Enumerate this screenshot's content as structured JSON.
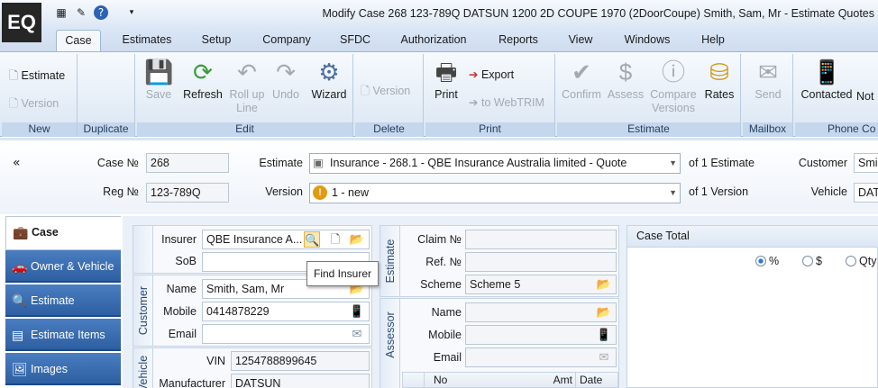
{
  "app": {
    "logo": "EQ",
    "title": "Modify Case 268 123-789Q DATSUN 1200  2D COUPE 1970 (2DoorCoupe) Smith, Sam, Mr - Estimate Quotes"
  },
  "menu": {
    "tabs": [
      "Case",
      "Estimates",
      "Setup",
      "Company",
      "SFDC",
      "Authorization",
      "Reports",
      "View",
      "Windows",
      "Help"
    ],
    "active": "Case"
  },
  "ribbon": {
    "new": {
      "label": "New",
      "estimate": "Estimate",
      "version": "Version"
    },
    "duplicate": {
      "label": "Duplicate"
    },
    "edit": {
      "label": "Edit",
      "save": "Save",
      "refresh": "Refresh",
      "rollup": "Roll up Line",
      "undo": "Undo",
      "wizard": "Wizard"
    },
    "delete": {
      "label": "Delete",
      "version": "Version"
    },
    "print": {
      "label": "Print",
      "print": "Print",
      "export": "Export",
      "webtrim": "to WebTRIM"
    },
    "estimate": {
      "label": "Estimate",
      "confirm": "Confirm",
      "assess": "Assess",
      "compare": "Compare Versions",
      "rates": "Rates"
    },
    "mailbox": {
      "label": "Mailbox",
      "send": "Send"
    },
    "phone": {
      "label": "Phone Co",
      "contacted": "Contacted",
      "not": "Not"
    }
  },
  "header": {
    "collapse": "«",
    "case_no_label": "Case №",
    "case_no": "268",
    "reg_no_label": "Reg №",
    "reg_no": "123-789Q",
    "estimate_label": "Estimate",
    "estimate_value": "Insurance - 268.1 - QBE Insurance Australia limited - Quote",
    "estimate_count": "of 1 Estimate",
    "version_label": "Version",
    "version_value": "1 - new",
    "version_count": "of 1 Version",
    "customer_label": "Customer",
    "customer_value": "Smi",
    "vehicle_label": "Vehicle",
    "vehicle_value": "DAT"
  },
  "nav": {
    "items": [
      {
        "label": "Case",
        "active": true
      },
      {
        "label": "Owner & Vehicle"
      },
      {
        "label": "Estimate"
      },
      {
        "label": "Estimate Items"
      },
      {
        "label": "Images"
      }
    ]
  },
  "insurer": {
    "insurer_label": "Insurer",
    "insurer_value": "QBE Insurance A...",
    "sob_label": "SoB",
    "sob_value": "",
    "tooltip": "Find Insurer"
  },
  "customer": {
    "section": "Customer",
    "name_label": "Name",
    "name_value": "Smith, Sam, Mr",
    "mobile_label": "Mobile",
    "mobile_value": "0414878229",
    "email_label": "Email",
    "email_value": ""
  },
  "vehicle": {
    "section": "Vehicle",
    "vin_label": "VIN",
    "vin_value": "1254788899645",
    "manufacturer_label": "Manufacturer",
    "manufacturer_value": "DATSUN"
  },
  "estimate_panel": {
    "section": "Estimate",
    "claim_label": "Claim №",
    "claim_value": "",
    "ref_label": "Ref. №",
    "ref_value": "",
    "scheme_label": "Scheme",
    "scheme_value": "Scheme 5"
  },
  "assessor": {
    "section": "Assessor",
    "name_label": "Name",
    "mobile_label": "Mobile",
    "email_label": "Email",
    "grid_headers": [
      "No",
      "Amt",
      "Date"
    ]
  },
  "case_total": {
    "title": "Case Total",
    "options": [
      "%",
      "$",
      "Qty"
    ],
    "selected": "%"
  }
}
